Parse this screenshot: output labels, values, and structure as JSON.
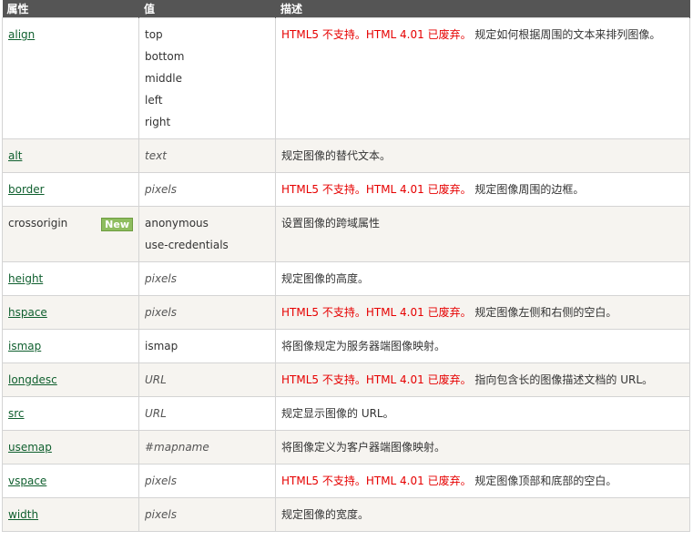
{
  "headers": [
    "属性",
    "值",
    "描述"
  ],
  "rows": [
    {
      "attr": "align",
      "values": [
        "top",
        "bottom",
        "middle",
        "left",
        "right"
      ],
      "deprecated": "HTML5 不支持。HTML 4.01 已废弃。",
      "desc": "规定如何根据周围的文本来排列图像。"
    },
    {
      "attr": "alt",
      "values": [
        "text"
      ],
      "deprecated": "",
      "desc": "规定图像的替代文本。"
    },
    {
      "attr": "border",
      "values": [
        "pixels"
      ],
      "deprecated": "HTML5 不支持。HTML 4.01 已废弃。",
      "desc": "规定图像周围的边框。"
    },
    {
      "attr": "crossorigin",
      "badge": "New",
      "values": [
        "anonymous",
        "use-credentials"
      ],
      "deprecated": "",
      "desc": "设置图像的跨域属性"
    },
    {
      "attr": "height",
      "values": [
        "pixels"
      ],
      "deprecated": "",
      "desc": "规定图像的高度。"
    },
    {
      "attr": "hspace",
      "values": [
        "pixels"
      ],
      "deprecated": "HTML5 不支持。HTML 4.01 已废弃。",
      "desc": "规定图像左侧和右侧的空白。"
    },
    {
      "attr": "ismap",
      "values": [
        "ismap"
      ],
      "deprecated": "",
      "desc": "将图像规定为服务器端图像映射。"
    },
    {
      "attr": "longdesc",
      "values": [
        "URL"
      ],
      "deprecated": "HTML5 不支持。HTML 4.01 已废弃。",
      "desc": "指向包含长的图像描述文档的 URL。"
    },
    {
      "attr": "src",
      "values": [
        "URL"
      ],
      "deprecated": "",
      "desc": "规定显示图像的 URL。"
    },
    {
      "attr": "usemap",
      "values": [
        "#mapname"
      ],
      "deprecated": "",
      "desc": "将图像定义为客户器端图像映射。"
    },
    {
      "attr": "vspace",
      "values": [
        "pixels"
      ],
      "deprecated": "HTML5 不支持。HTML 4.01 已废弃。",
      "desc": "规定图像顶部和底部的空白。"
    },
    {
      "attr": "width",
      "values": [
        "pixels"
      ],
      "deprecated": "",
      "desc": "规定图像的宽度。"
    }
  ]
}
